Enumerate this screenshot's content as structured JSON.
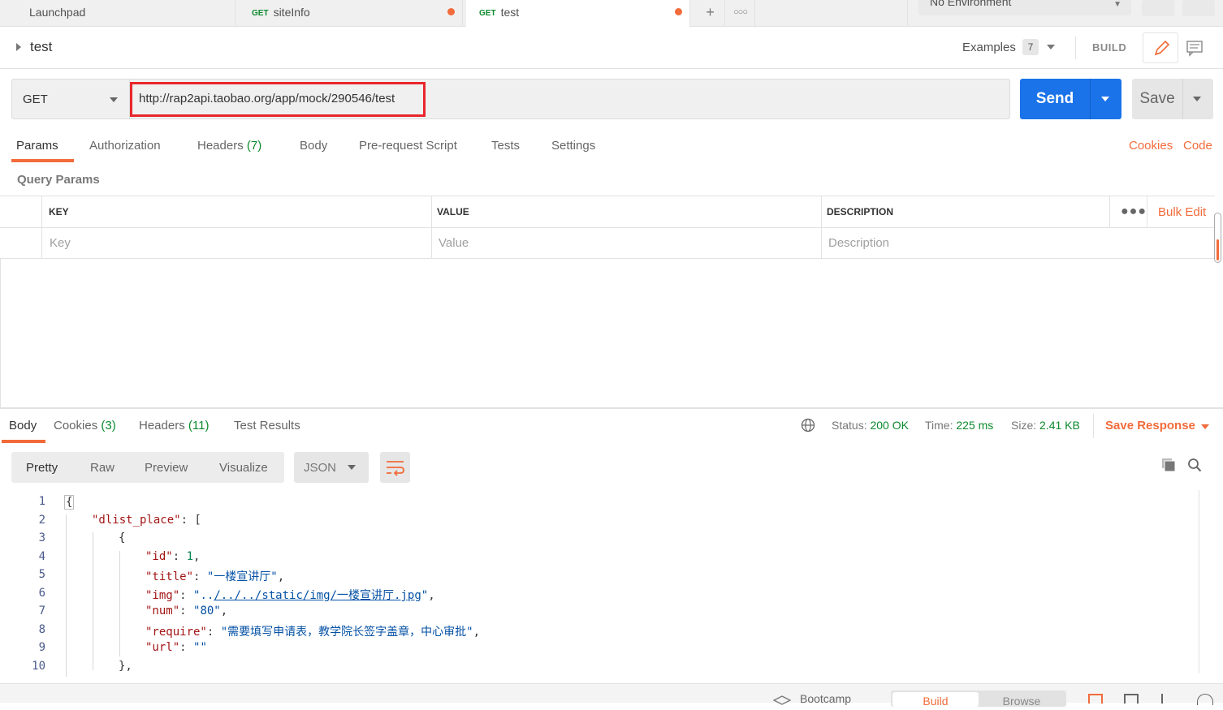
{
  "tabs": [
    {
      "label": "Launchpad"
    },
    {
      "method": "GET",
      "label": "siteInfo",
      "unsaved": true
    },
    {
      "method": "GET",
      "label": "test",
      "unsaved": true,
      "active": true
    }
  ],
  "environment": {
    "label": "No Environment"
  },
  "request": {
    "name": "test",
    "examples_label": "Examples",
    "examples_count": "7",
    "build_label": "BUILD",
    "method": "GET",
    "url": "http://rap2api.taobao.org/app/mock/290546/test",
    "send_label": "Send",
    "save_label": "Save"
  },
  "request_tabs": {
    "params": "Params",
    "authorization": "Authorization",
    "headers": "Headers",
    "headers_count": "(7)",
    "body": "Body",
    "prerequest": "Pre-request Script",
    "tests": "Tests",
    "settings": "Settings",
    "cookies": "Cookies",
    "code": "Code"
  },
  "query_params": {
    "title": "Query Params",
    "headers": {
      "key": "KEY",
      "value": "VALUE",
      "description": "DESCRIPTION"
    },
    "placeholders": {
      "key": "Key",
      "value": "Value",
      "description": "Description"
    },
    "bulk_edit": "Bulk Edit"
  },
  "response": {
    "tabs": {
      "body": "Body",
      "cookies": "Cookies",
      "cookies_count": "(3)",
      "headers": "Headers",
      "headers_count": "(11)",
      "test_results": "Test Results"
    },
    "status_label": "Status:",
    "status_value": "200 OK",
    "time_label": "Time:",
    "time_value": "225 ms",
    "size_label": "Size:",
    "size_value": "2.41 KB",
    "save_response": "Save Response",
    "views": {
      "pretty": "Pretty",
      "raw": "Raw",
      "preview": "Preview",
      "visualize": "Visualize"
    },
    "format": "JSON"
  },
  "code_lines": [
    {
      "n": "1",
      "brace": "{"
    },
    {
      "n": "2",
      "key": "\"dlist_place\"",
      "rest": ": ["
    },
    {
      "n": "3",
      "brace": "{"
    },
    {
      "n": "4",
      "key": "\"id\"",
      "colon": ": ",
      "num": "1",
      "tail": ","
    },
    {
      "n": "5",
      "key": "\"title\"",
      "colon": ": ",
      "str": "\"一楼宣讲厅\"",
      "tail": ","
    },
    {
      "n": "6",
      "key": "\"img\"",
      "colon": ": ",
      "str_pre": "\"..",
      "link": "/../../static/img/一楼宣讲厅.jpg",
      "str_post": "\"",
      "tail": ","
    },
    {
      "n": "7",
      "key": "\"num\"",
      "colon": ": ",
      "str": "\"80\"",
      "tail": ","
    },
    {
      "n": "8",
      "key": "\"require\"",
      "colon": ": ",
      "str": "\"需要填写申请表，教学院长签字盖章，中心审批\"",
      "tail": ","
    },
    {
      "n": "9",
      "key": "\"url\"",
      "colon": ": ",
      "str": "\"\""
    },
    {
      "n": "10",
      "brace": "},"
    }
  ],
  "bottom_bar": {
    "bootcamp": "Bootcamp",
    "build": "Build",
    "browse": "Browse"
  }
}
